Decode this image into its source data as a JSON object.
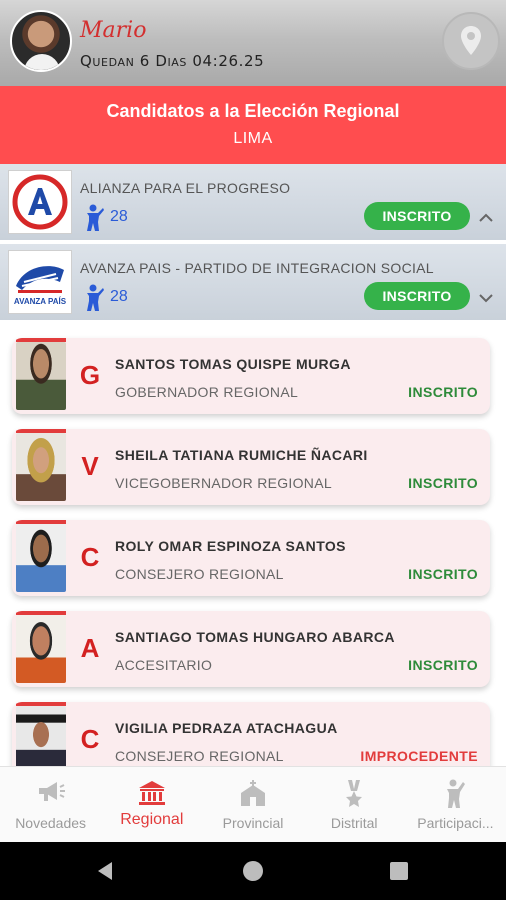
{
  "header": {
    "user_name": "Mario",
    "countdown": "Quedan 6 Dias 04:26.25"
  },
  "banner": {
    "title": "Candidatos a la Elección Regional",
    "subtitle": "LIMA"
  },
  "parties": [
    {
      "name": "ALIANZA PARA EL PROGRESO",
      "count": "28",
      "status": "INSCRITO",
      "expanded": false
    },
    {
      "name": "AVANZA PAIS - PARTIDO DE INTEGRACION SOCIAL",
      "count": "28",
      "status": "INSCRITO",
      "expanded": true,
      "logo_text": "AVANZA PAÍS"
    }
  ],
  "candidates": [
    {
      "letter": "G",
      "name": "SANTOS TOMAS QUISPE MURGA",
      "role": "GOBERNADOR REGIONAL",
      "status": "INSCRITO"
    },
    {
      "letter": "V",
      "name": "SHEILA TATIANA RUMICHE ÑACARI",
      "role": "VICEGOBERNADOR REGIONAL",
      "status": "INSCRITO"
    },
    {
      "letter": "C",
      "name": "ROLY OMAR ESPINOZA SANTOS",
      "role": "CONSEJERO REGIONAL",
      "status": "INSCRITO"
    },
    {
      "letter": "A",
      "name": "SANTIAGO TOMAS HUNGARO ABARCA",
      "role": "ACCESITARIO",
      "status": "INSCRITO"
    },
    {
      "letter": "C",
      "name": "VIGILIA PEDRAZA ATACHAGUA",
      "role": "CONSEJERO REGIONAL",
      "status": "IMPROCEDENTE"
    }
  ],
  "nav": {
    "items": [
      {
        "label": "Novedades",
        "icon": "megaphone-icon",
        "active": false
      },
      {
        "label": "Regional",
        "icon": "institution-icon",
        "active": true
      },
      {
        "label": "Provincial",
        "icon": "church-icon",
        "active": false
      },
      {
        "label": "Distrital",
        "icon": "medal-icon",
        "active": false
      },
      {
        "label": "Participaci...",
        "icon": "person-raise-icon",
        "active": false
      }
    ]
  },
  "colors": {
    "accent_red": "#ff4d4f",
    "status_green": "#35b24a",
    "status_red": "#e23c3c",
    "link_blue": "#2a5bd7"
  }
}
